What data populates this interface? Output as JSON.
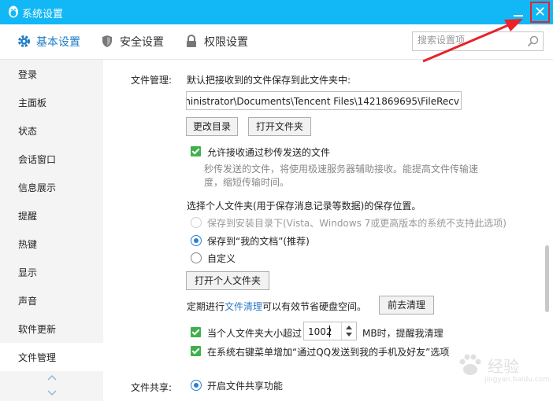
{
  "window": {
    "title": "系统设置"
  },
  "colors": {
    "title_bar": "#12b7f5",
    "accent": "#1e7cc7",
    "check": "#3fb14a",
    "highlight_red": "#e8232a"
  },
  "toolbar": {
    "tabs": [
      {
        "label": "基本设置",
        "icon": "gear-icon",
        "active": true
      },
      {
        "label": "安全设置",
        "icon": "shield-icon",
        "active": false
      },
      {
        "label": "权限设置",
        "icon": "lock-icon",
        "active": false
      }
    ],
    "search_placeholder": "搜索设置项"
  },
  "sidebar": {
    "items": [
      {
        "label": "登录"
      },
      {
        "label": "主面板"
      },
      {
        "label": "状态"
      },
      {
        "label": "会话窗口"
      },
      {
        "label": "信息展示"
      },
      {
        "label": "提醒"
      },
      {
        "label": "热键"
      },
      {
        "label": "显示"
      },
      {
        "label": "声音"
      },
      {
        "label": "软件更新"
      },
      {
        "label": "文件管理",
        "active": true
      }
    ]
  },
  "file_management": {
    "section_label": "文件管理:",
    "save_location_label": "默认把接收到的文件保存到此文件夹中:",
    "path_value": "dministrator\\Documents\\Tencent Files\\1421869695\\FileRecv",
    "change_dir_button": "更改目录",
    "open_folder_button": "打开文件夹",
    "allow_transfer_label": "允许接收通过秒传发送的文件",
    "allow_transfer_checked": true,
    "transfer_desc_line1": "秒传发送的文件，将使用极速服务器辅助接收。能提高文件传输速",
    "transfer_desc_line2": "度，缩短传输时间。",
    "personal_folder_label": "选择个人文件夹(用于保存消息记录等数据)的保存位置。",
    "radio_options": [
      {
        "label": "保存到安装目录下(Vista、Windows 7或更高版本的系统不支持此选项)",
        "selected": false,
        "disabled": true
      },
      {
        "label": "保存到“我的文档”(推荐)",
        "selected": true,
        "disabled": false
      },
      {
        "label": "自定义",
        "selected": false,
        "disabled": false
      }
    ],
    "open_personal_folder_button": "打开个人文件夹",
    "cleanup_prefix": "定期进行",
    "cleanup_link": "文件清理",
    "cleanup_suffix": "可以有效节省硬盘空间。",
    "cleanup_button": "前去清理",
    "size_remind_label": "当个人文件夹大小超过",
    "size_remind_checked": true,
    "size_value": "1002",
    "size_unit_label": "MB时，提醒我清理",
    "context_menu_label": "在系统右键菜单增加“通过QQ发送到我的手机及好友”选项",
    "context_menu_checked": true
  },
  "file_sharing": {
    "section_label": "文件共享:",
    "enable_label": "开启文件共享功能",
    "enable_selected": true
  },
  "watermark": {
    "text": "经验",
    "subtext": "jingyan.baidu.com"
  }
}
